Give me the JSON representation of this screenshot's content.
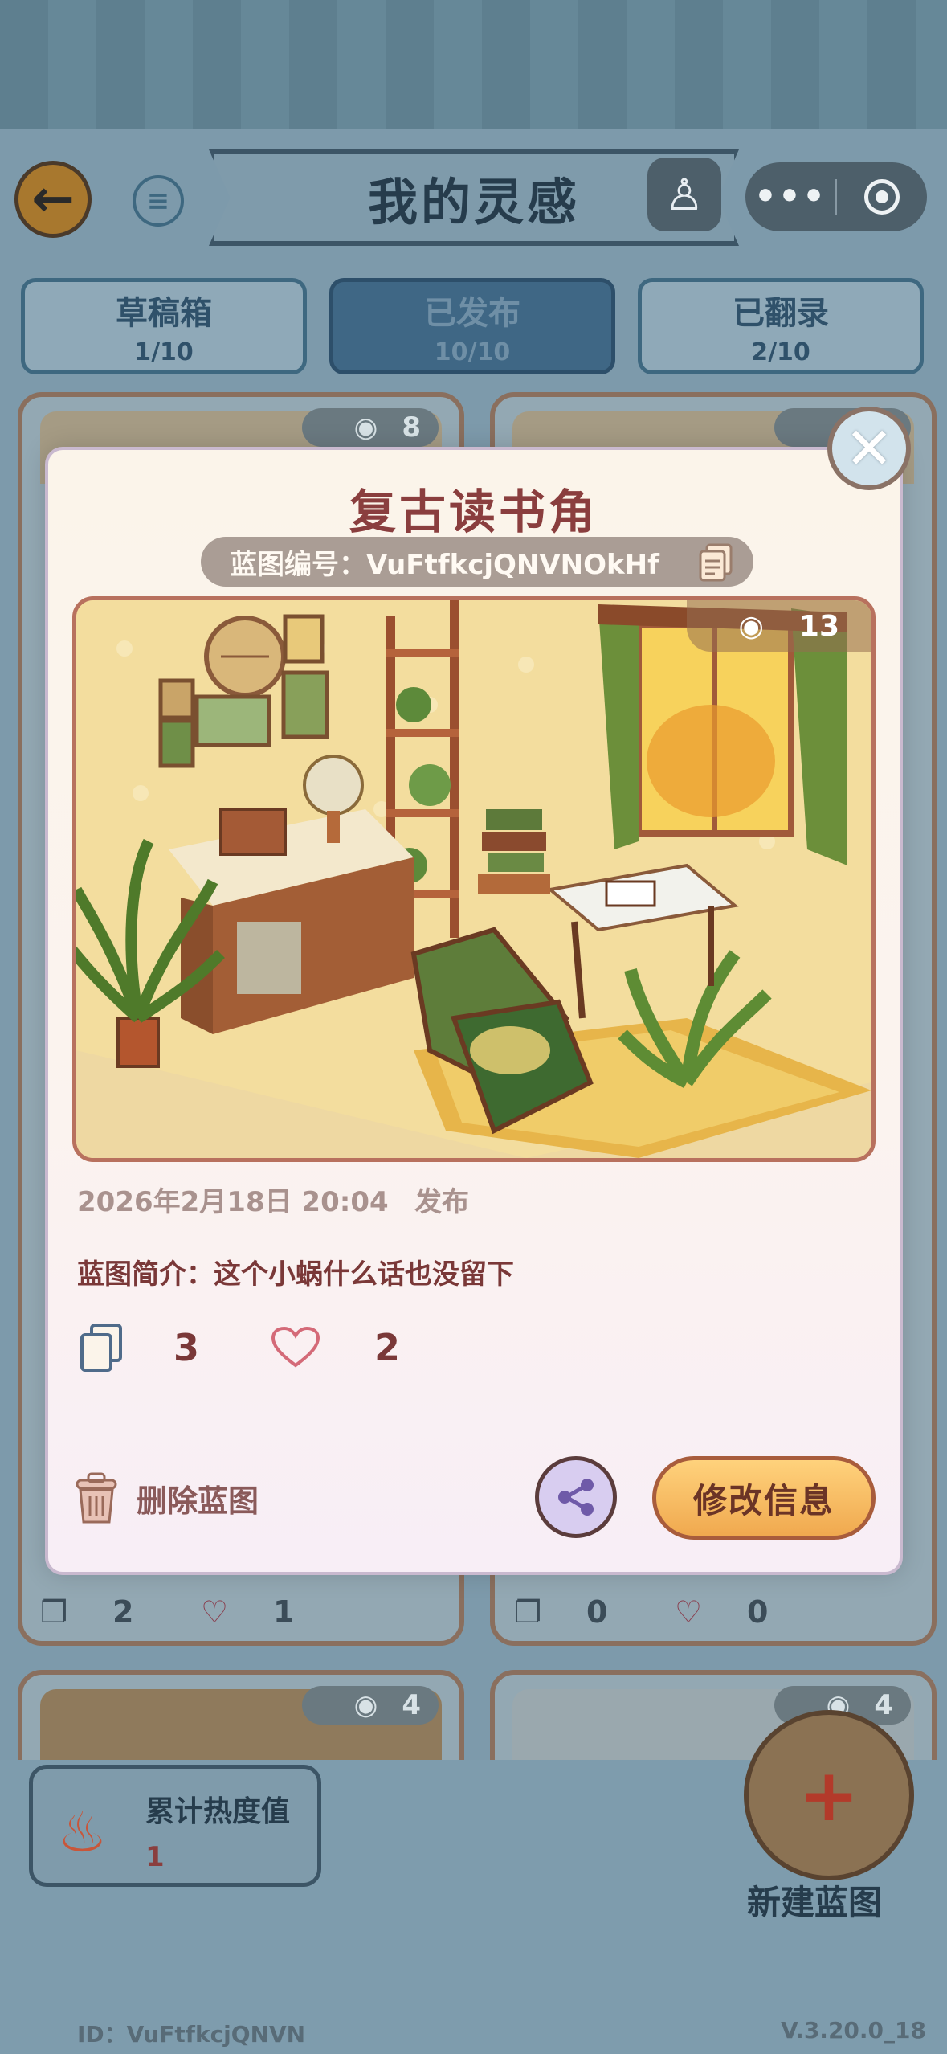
{
  "header": {
    "back_glyph": "←",
    "list_glyph": "≡",
    "title": "我的灵感",
    "user_glyph": "♙",
    "menu_glyph": "•••"
  },
  "tabs": [
    {
      "label": "草稿箱",
      "count": "1/10",
      "active": false
    },
    {
      "label": "已发布",
      "count": "10/10",
      "active": true
    },
    {
      "label": "已翻录",
      "count": "2/10",
      "active": false
    }
  ],
  "bg_cards": [
    {
      "views": "8"
    },
    {
      "views": ""
    },
    {
      "views": "4"
    },
    {
      "views": "4"
    }
  ],
  "bg_stats": [
    {
      "copies": "2",
      "likes": "1"
    },
    {
      "copies": "0",
      "likes": "0"
    }
  ],
  "heat": {
    "label": "累计热度值",
    "value": "1"
  },
  "new_blueprint_label": "新建蓝图",
  "footer": {
    "id": "ID：VuFtfkcjQNVN",
    "version": "V.3.20.0_18"
  },
  "modal": {
    "close_glyph": "✕",
    "title": "复古读书角",
    "code_text": "蓝图编号：VuFtfkcjQNVNOkHf",
    "views": "13",
    "date": "2026年2月18日 20:04",
    "publish_label": "发布",
    "description": "蓝图简介：这个小蜗什么话也没留下",
    "copies": "3",
    "likes": "2",
    "delete_label": "删除蓝图",
    "edit_label": "修改信息"
  },
  "colors": {
    "accent": "#8a3e3e",
    "button_orange": "#f0a94f",
    "header_blue": "#3e6880"
  }
}
